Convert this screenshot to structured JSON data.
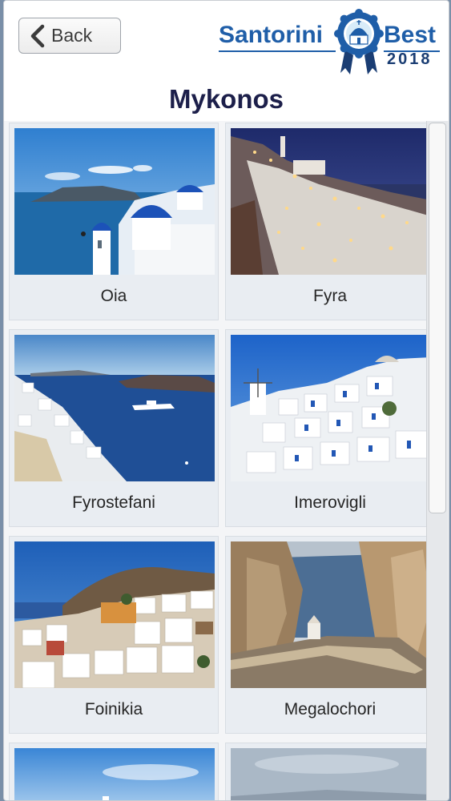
{
  "header": {
    "back_label": "Back",
    "logo_word1": "Santorini",
    "logo_word2": "Best",
    "logo_year": "2018"
  },
  "page_title": "Mykonos",
  "places": [
    {
      "name": "Oia"
    },
    {
      "name": "Fyra"
    },
    {
      "name": "Fyrostefani"
    },
    {
      "name": "Imerovigli"
    },
    {
      "name": "Foinikia"
    },
    {
      "name": "Megalochori"
    }
  ],
  "colors": {
    "brand_blue": "#1f5ea8",
    "title_navy": "#1c1f4a"
  },
  "icons": {
    "back": "chevron-left-icon",
    "logo_badge": "rosette-badge-icon"
  },
  "scroll": {
    "position_fraction": 0.0,
    "visible_fraction": 0.58
  }
}
